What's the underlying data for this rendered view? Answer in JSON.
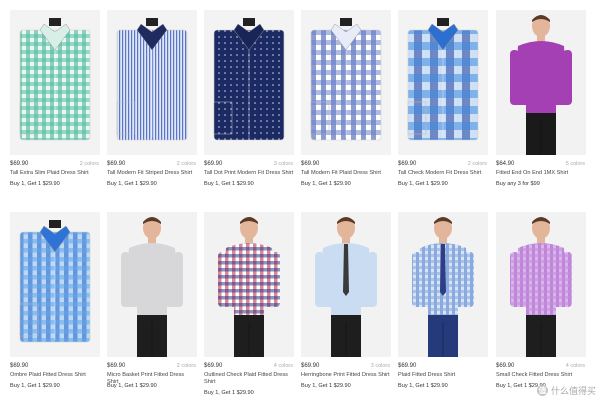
{
  "products": [
    {
      "price": "$69.90",
      "colors": "2 colors",
      "name": "Tall Extra Slim Plaid Dress Shirt",
      "promo": "Buy 1, Get 1 $29.90",
      "art": "plaid-green"
    },
    {
      "price": "$69.90",
      "colors": "2 colors",
      "name": "Tall Modern Fit Striped Dress Shirt",
      "promo": "Buy 1, Get 1 $29.90",
      "art": "stripe-blue"
    },
    {
      "price": "$69.90",
      "colors": "3 colors",
      "name": "Tall Dot Print Modern Fit Dress Shirt",
      "promo": "Buy 1, Get 1 $29.90",
      "art": "dot-navy"
    },
    {
      "price": "$69.90",
      "colors": "",
      "name": "Tall Modern Fit Plaid Dress Shirt",
      "promo": "Buy 1, Get 1 $29.90",
      "art": "plaid-blue-white"
    },
    {
      "price": "$69.90",
      "colors": "2 colors",
      "name": "Tall Check Modern Fit Dress Shirt",
      "promo": "Buy 1, Get 1 $29.90",
      "art": "check-blue"
    },
    {
      "price": "$64.90",
      "colors": "5 colors",
      "name": "Fitted End On End 1MX Shirt",
      "promo": "Buy any 3 for $99",
      "art": "model-purple"
    },
    {
      "price": "$69.90",
      "colors": "",
      "name": "Ombre Plaid Fitted Dress Shirt",
      "promo": "Buy 1, Get 1 $29.90",
      "art": "plaid-ombre"
    },
    {
      "price": "$69.90",
      "colors": "2 colors",
      "name": "Micro Basket Print Fitted Dress Shirt",
      "promo": "Buy 1, Get 1 $29.90",
      "art": "model-grey"
    },
    {
      "price": "$69.90",
      "colors": "4 colors",
      "name": "Outlined Check Plaid Fitted Dress Shirt",
      "promo": "Buy 1, Get 1 $29.90",
      "art": "model-redcheck"
    },
    {
      "price": "$69.90",
      "colors": "3 colors",
      "name": "Herringbone Print Fitted Dress Shirt",
      "promo": "Buy 1, Get 1 $29.90",
      "art": "model-lightblue"
    },
    {
      "price": "$69.90",
      "colors": "",
      "name": "Plaid Fitted Dress Shirt",
      "promo": "Buy 1, Get 1 $29.90",
      "art": "model-blueplaid"
    },
    {
      "price": "$69.90",
      "colors": "4 colors",
      "name": "Small Check Fitted Dress Shirt",
      "promo": "Buy 1, Get 1 $29.90",
      "art": "model-purplecheck"
    }
  ],
  "watermark": {
    "text": "什么值得买",
    "icon": "值"
  }
}
